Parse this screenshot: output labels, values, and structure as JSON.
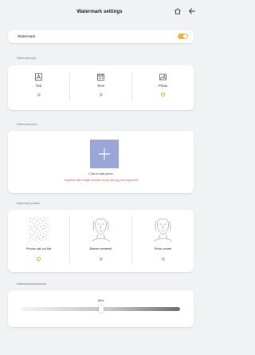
{
  "header": {
    "title": "Watermark settings",
    "home_icon": "home-icon",
    "back_icon": "back-arrow-icon"
  },
  "watermark_toggle": {
    "label": "Watermark",
    "on": true,
    "accent": "#f1b23c"
  },
  "type_section": {
    "label": "Watermark style",
    "options": [
      {
        "label": "Text",
        "icon": "text-icon",
        "selected": false
      },
      {
        "label": "Time",
        "icon": "calendar-icon",
        "selected": false
      },
      {
        "label": "Photo",
        "icon": "image-icon",
        "selected": true
      }
    ]
  },
  "photo_section": {
    "label": "Watermark photo",
    "add_label": "Click to add photo",
    "warning": "Only files with image formats of png and jpg are supported",
    "add_color": "#9aa5d8",
    "warning_color": "#e24e3e"
  },
  "position_section": {
    "label": "Watermark position",
    "options": [
      {
        "label": "Photos laid out flat",
        "selected": true
      },
      {
        "label": "Bottom centered",
        "selected": false
      },
      {
        "label": "Photo center",
        "selected": false
      }
    ]
  },
  "frequency_section": {
    "label": "Watermark transparency",
    "value_label": "50%",
    "value": 0.5
  }
}
